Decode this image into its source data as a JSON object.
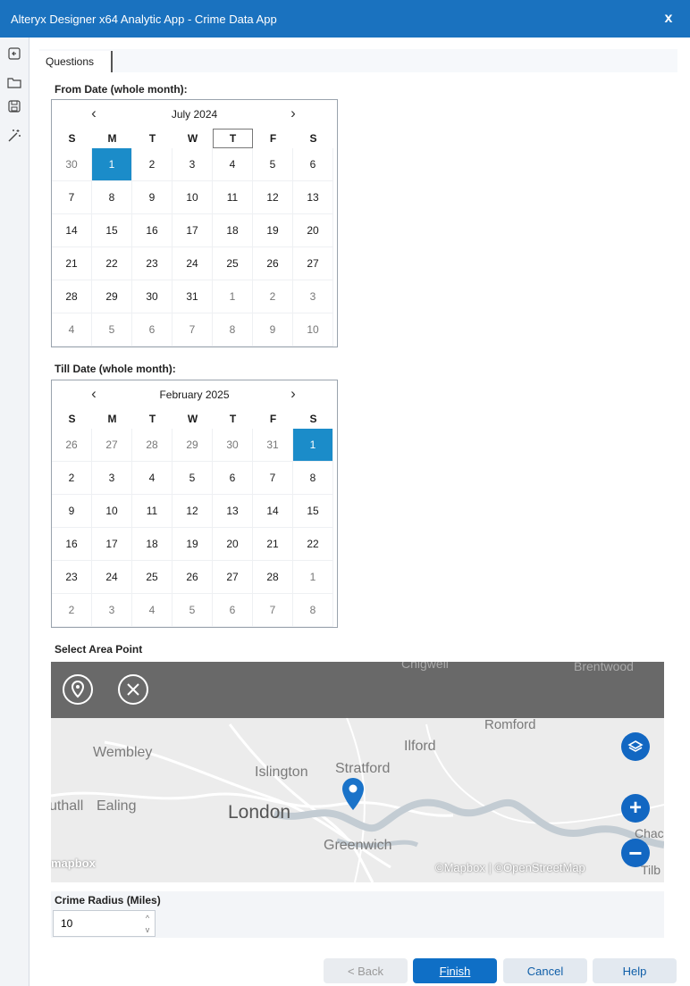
{
  "window": {
    "title": "Alteryx Designer x64 Analytic App - Crime Data App",
    "close_glyph": "x"
  },
  "left_toolbar": [
    "back-icon",
    "folder-icon",
    "save-icon",
    "magic-wand-icon"
  ],
  "tab": {
    "label": "Questions"
  },
  "from_date": {
    "label": "From Date (whole month):",
    "month": "July 2024",
    "dow": [
      "S",
      "M",
      "T",
      "W",
      "T",
      "F",
      "S"
    ],
    "weeks": [
      [
        "30",
        "1",
        "2",
        "3",
        "4",
        "5",
        "6"
      ],
      [
        "7",
        "8",
        "9",
        "10",
        "11",
        "12",
        "13"
      ],
      [
        "14",
        "15",
        "16",
        "17",
        "18",
        "19",
        "20"
      ],
      [
        "21",
        "22",
        "23",
        "24",
        "25",
        "26",
        "27"
      ],
      [
        "28",
        "29",
        "30",
        "31",
        "1",
        "2",
        "3"
      ],
      [
        "4",
        "5",
        "6",
        "7",
        "8",
        "9",
        "10"
      ]
    ]
  },
  "till_date": {
    "label": "Till Date (whole month):",
    "month": "February 2025",
    "dow": [
      "S",
      "M",
      "T",
      "W",
      "T",
      "F",
      "S"
    ],
    "weeks": [
      [
        "26",
        "27",
        "28",
        "29",
        "30",
        "31",
        "1"
      ],
      [
        "2",
        "3",
        "4",
        "5",
        "6",
        "7",
        "8"
      ],
      [
        "9",
        "10",
        "11",
        "12",
        "13",
        "14",
        "15"
      ],
      [
        "16",
        "17",
        "18",
        "19",
        "20",
        "21",
        "22"
      ],
      [
        "23",
        "24",
        "25",
        "26",
        "27",
        "28",
        "1"
      ],
      [
        "2",
        "3",
        "4",
        "5",
        "6",
        "7",
        "8"
      ]
    ]
  },
  "area": {
    "label": "Select Area Point",
    "places": {
      "chigwell": "Chigwell",
      "brentwood": "Brentwood",
      "romford": "Romford",
      "ilford": "Ilford",
      "wembley": "Wembley",
      "islington": "Islington",
      "stratford": "Stratford",
      "southall": "uthall",
      "ealing": "Ealing",
      "london": "London",
      "greenwich": "Greenwich",
      "chadwell": "Chac",
      "tilbury": "Tilb"
    },
    "logo": "mapbox",
    "attribution": "©Mapbox | ©OpenStreetMap",
    "zoom_in": "+",
    "zoom_out": "−"
  },
  "radius": {
    "label": "Crime Radius (Miles)",
    "value": "10"
  },
  "buttons": {
    "back": "< Back",
    "finish": "Finish",
    "cancel": "Cancel",
    "help": "Help"
  },
  "colors": {
    "titlebar": "#1a72bf",
    "selected_day": "#1b8cc9",
    "finish": "#0f6fc6",
    "map_button": "#1267c2"
  }
}
